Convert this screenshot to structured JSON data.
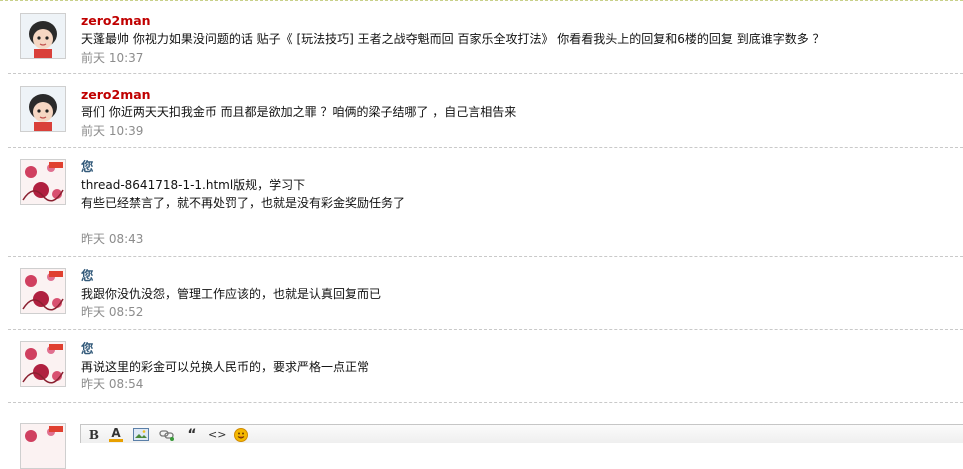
{
  "messages": [
    {
      "author": "zero2man",
      "avatar_icon": "cartoon-girl-avatar",
      "lines": [
        "天蓬最帅 你视力如果没问题的话 贴子《 [玩法技巧] 王者之战夺魁而回 百家乐全攻打法》 你看看我头上的回复和6楼的回复 到底谁字数多 ？"
      ],
      "time": "前天 10:37"
    },
    {
      "author": "zero2man",
      "avatar_icon": "cartoon-girl-avatar",
      "lines": [
        "哥们 你近两天天扣我金币 而且都是欲加之罪 ？咱俩的梁子结哪了 ，自己言相告来"
      ],
      "time": "前天 10:39"
    },
    {
      "author": "您",
      "avatar_icon": "floral-pattern-avatar",
      "lines": [
        "thread-8641718-1-1.html版规，学习下",
        "有些已经禁言了，就不再处罚了，也就是没有彩金奖励任务了"
      ],
      "time": "昨天 08:43"
    },
    {
      "author": "您",
      "avatar_icon": "floral-pattern-avatar",
      "lines": [
        "我跟你没仇没怨，管理工作应该的，也就是认真回复而已"
      ],
      "time": "昨天 08:52"
    },
    {
      "author": "您",
      "avatar_icon": "floral-pattern-avatar",
      "lines": [
        "再说这里的彩金可以兑换人民币的，要求严格一点正常"
      ],
      "time": "昨天 08:54"
    }
  ],
  "editor": {
    "bold_label": "B",
    "font_color_label": "A",
    "quote_label": "“",
    "code_label": "<>",
    "font_color_accent": "#e8a000"
  },
  "colors": {
    "author_other": "#c00000",
    "author_self": "#335a7a",
    "timestamp": "#8c8c8c"
  }
}
